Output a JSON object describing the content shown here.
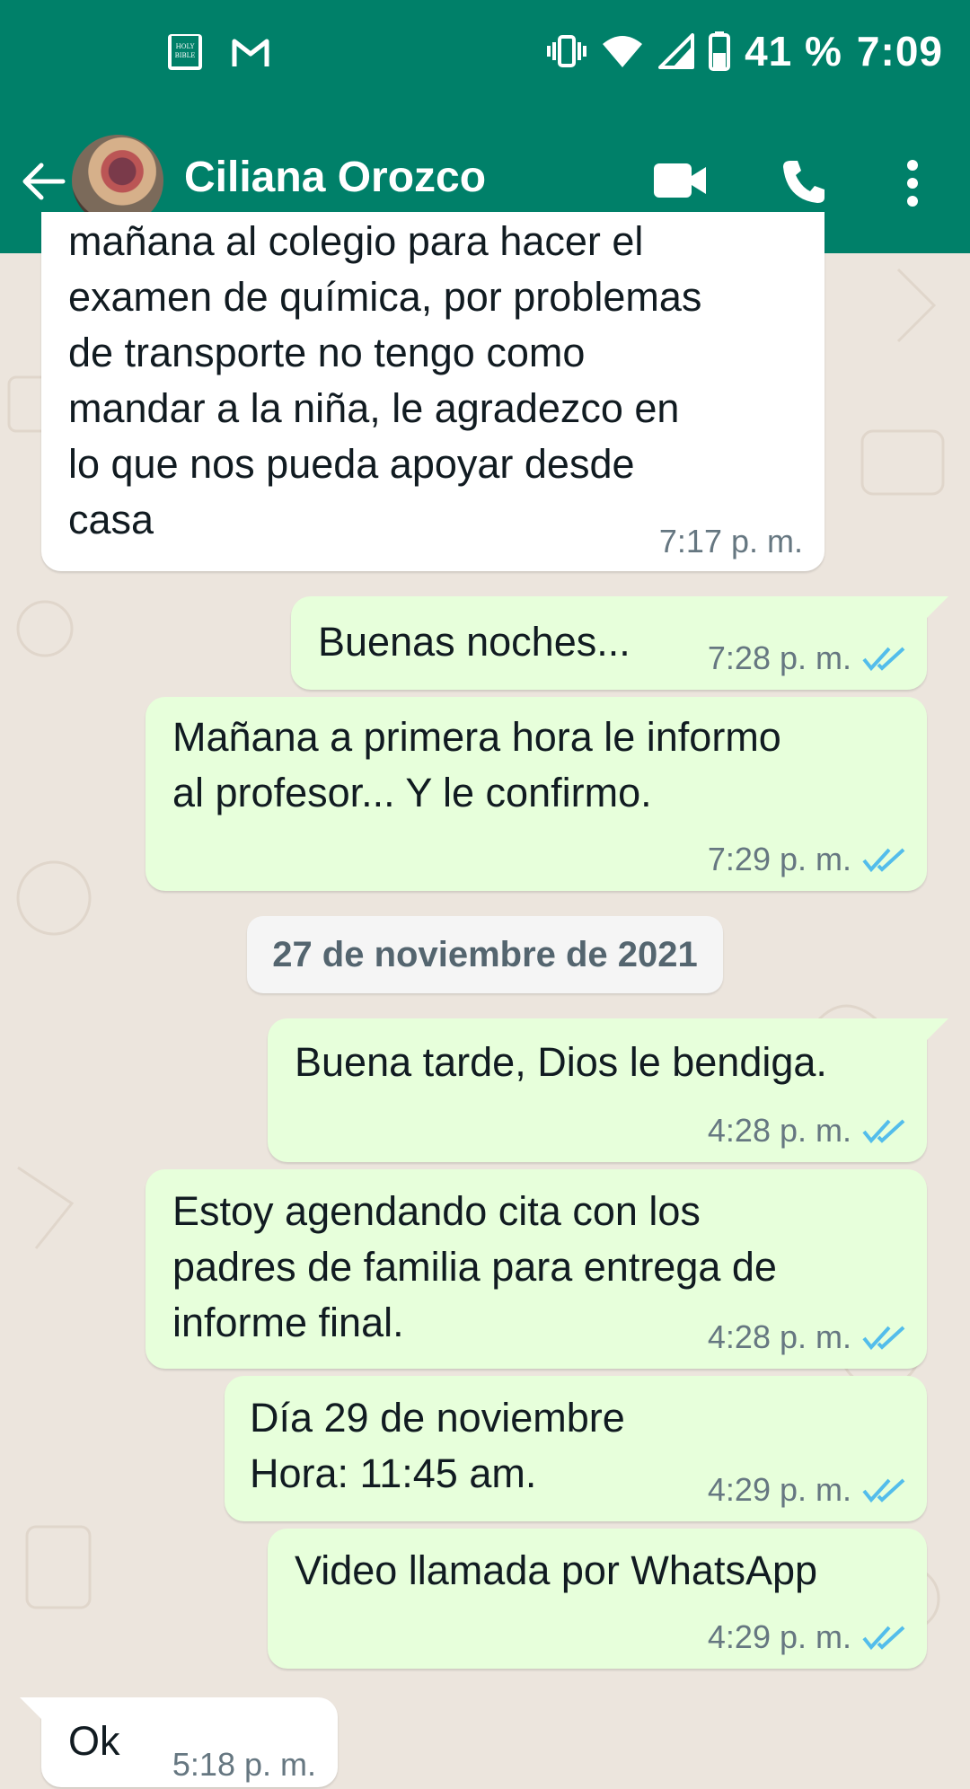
{
  "status_bar": {
    "left_icons": [
      "holy-bible-icon",
      "gmail-icon"
    ],
    "bible_icon_text": "HOLY BIBLE",
    "right_icons": [
      "vibrate-icon",
      "wifi-icon",
      "signal-icon",
      "battery-icon"
    ],
    "battery": "41 %",
    "time": "7:09"
  },
  "app_bar": {
    "contact_name": "Ciliana Orozco",
    "icons": [
      "back-arrow-icon",
      "video-call-icon",
      "phone-icon",
      "more-vert-icon"
    ]
  },
  "messages": [
    {
      "dir": "in",
      "text": "mañana al colegio para hacer el\nexamen de química, por problemas\nde transporte no tengo como\nmandar a la niña, le agradezco en\nlo que nos pueda apoyar desde\ncasa",
      "time": "7:17 p. m."
    },
    {
      "dir": "out",
      "text": "Buenas noches...",
      "time": "7:28 p. m."
    },
    {
      "dir": "out",
      "text": "Mañana a primera hora le informo\nal profesor... Y le confirmo.",
      "time": "7:29 p. m."
    },
    {
      "dir": "out",
      "text": "Buena tarde, Dios le bendiga.",
      "time": "4:28 p. m."
    },
    {
      "dir": "out",
      "text": "Estoy agendando cita con los\npadres de familia para entrega de\ninforme final.",
      "time": "4:28 p. m."
    },
    {
      "dir": "out",
      "text": "Día 29 de noviembre\nHora: 11:45 am.",
      "time": "4:29 p. m."
    },
    {
      "dir": "out",
      "text": "Video llamada por WhatsApp",
      "time": "4:29 p. m."
    },
    {
      "dir": "in",
      "text": "Ok",
      "time": "5:18 p. m."
    }
  ],
  "date_divider": "27 de noviembre de 2021",
  "colors": {
    "header": "#008069",
    "outgoing_bubble": "#e7ffdb",
    "incoming_bubble": "#ffffff",
    "read_ticks": "#53bdeb",
    "chat_background": "#ece5dd"
  }
}
